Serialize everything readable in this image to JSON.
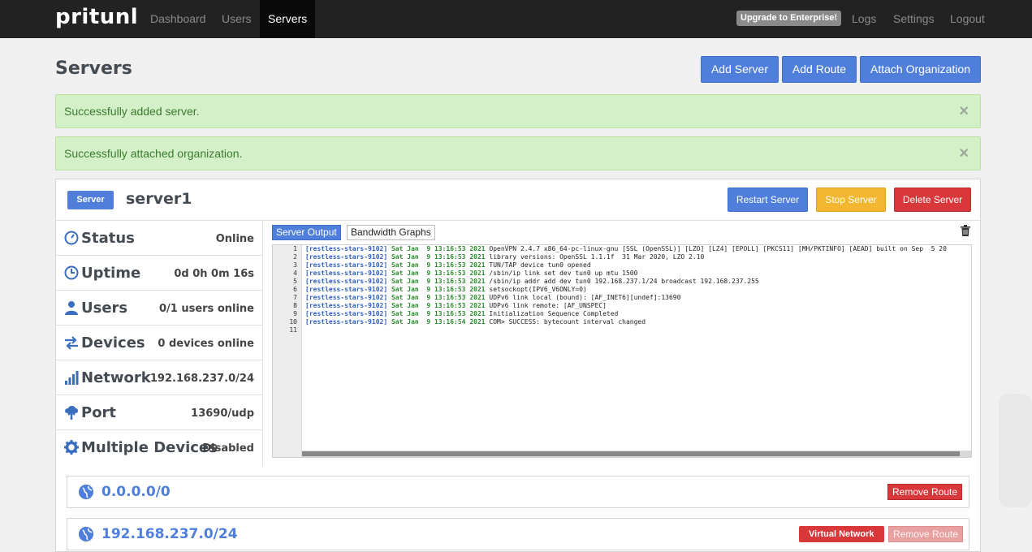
{
  "nav": {
    "brand": "pritunl",
    "items": [
      "Dashboard",
      "Users",
      "Servers"
    ],
    "upgrade": "Upgrade to Enterprise!",
    "right": [
      "Logs",
      "Settings",
      "Logout"
    ]
  },
  "page": {
    "title": "Servers",
    "add_server": "Add Server",
    "add_route": "Add Route",
    "attach_org": "Attach Organization"
  },
  "alerts": [
    "Successfully added server.",
    "Successfully attached organization."
  ],
  "alert_close": "×",
  "server": {
    "badge": "Server",
    "name": "server1",
    "restart": "Restart Server",
    "stop": "Stop Server",
    "delete": "Delete Server",
    "info": [
      {
        "label": "Status",
        "value": "Online",
        "icon": "status-icon"
      },
      {
        "label": "Uptime",
        "value": "0d 0h 0m 16s",
        "icon": "clock-icon"
      },
      {
        "label": "Users",
        "value": "0/1 users online",
        "icon": "user-icon"
      },
      {
        "label": "Devices",
        "value": "0 devices online",
        "icon": "transfer-icon"
      },
      {
        "label": "Network",
        "value": "192.168.237.0/24",
        "icon": "signal-icon"
      },
      {
        "label": "Port",
        "value": "13690/udp",
        "icon": "upload-icon"
      },
      {
        "label": "Multiple Devices",
        "value": "Disabled",
        "icon": "gear-icon"
      }
    ],
    "tabs": [
      "Server Output",
      "Bandwidth Graphs"
    ],
    "log": {
      "tag": "[restless-stars-9102]",
      "lines": [
        {
          "date": "Sat Jan  9 13:16:53 2021",
          "msg": "OpenVPN 2.4.7 x86_64-pc-linux-gnu [SSL (OpenSSL)] [LZO] [LZ4] [EPOLL] [PKCS11] [MH/PKTINFO] [AEAD] built on Sep  5 20"
        },
        {
          "date": "Sat Jan  9 13:16:53 2021",
          "msg": "library versions: OpenSSL 1.1.1f  31 Mar 2020, LZO 2.10"
        },
        {
          "date": "Sat Jan  9 13:16:53 2021",
          "msg": "TUN/TAP device tun0 opened"
        },
        {
          "date": "Sat Jan  9 13:16:53 2021",
          "msg": "/sbin/ip link set dev tun0 up mtu 1500"
        },
        {
          "date": "Sat Jan  9 13:16:53 2021",
          "msg": "/sbin/ip addr add dev tun0 192.168.237.1/24 broadcast 192.168.237.255"
        },
        {
          "date": "Sat Jan  9 13:16:53 2021",
          "msg": "setsockopt(IPV6_V6ONLY=0)"
        },
        {
          "date": "Sat Jan  9 13:16:53 2021",
          "msg": "UDPv6 link local (bound): [AF_INET6][undef]:13690"
        },
        {
          "date": "Sat Jan  9 13:16:53 2021",
          "msg": "UDPv6 link remote: [AF_UNSPEC]"
        },
        {
          "date": "Sat Jan  9 13:16:53 2021",
          "msg": "Initialization Sequence Completed"
        },
        {
          "date": "Sat Jan  9 13:16:54 2021",
          "msg": "COM> SUCCESS: bytecount interval changed"
        }
      ],
      "line_numbers": [
        "1",
        "2",
        "3",
        "4",
        "5",
        "6",
        "7",
        "8",
        "9",
        "10",
        "11"
      ]
    }
  },
  "routes": [
    {
      "name": "0.0.0.0/0",
      "remove": "Remove Route"
    },
    {
      "name": "192.168.237.0/24",
      "badge": "Virtual Network",
      "remove": "Remove Route"
    }
  ]
}
